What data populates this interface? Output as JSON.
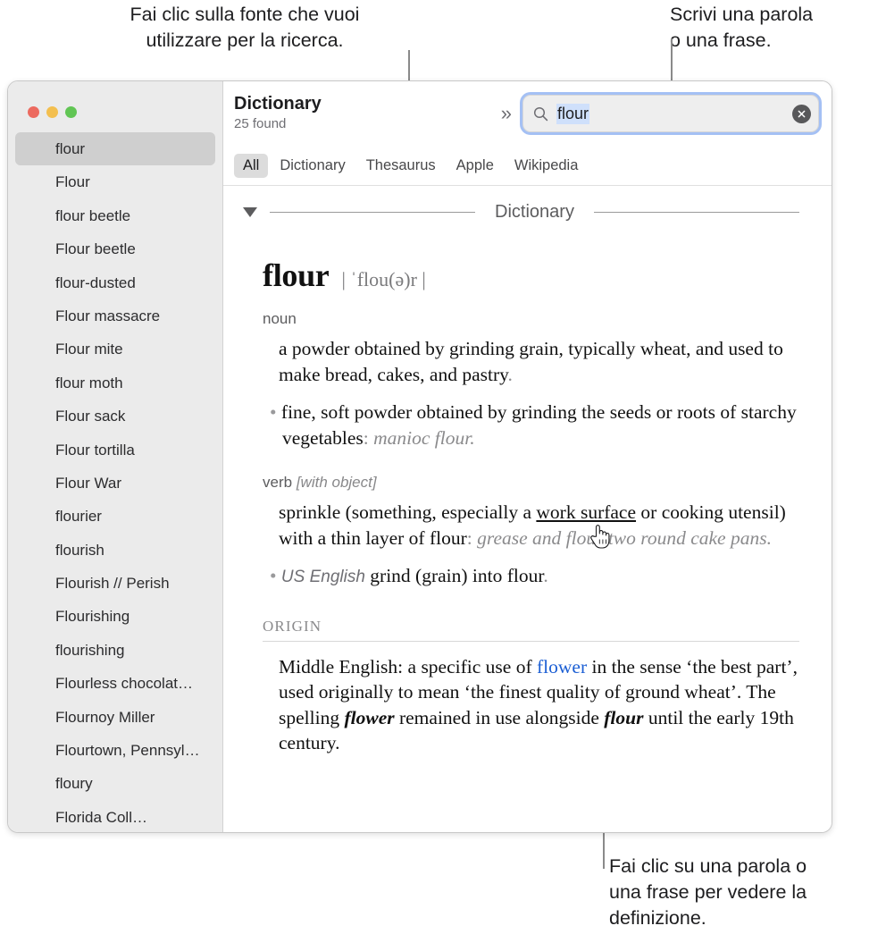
{
  "callouts": {
    "source": "Fai clic sulla fonte che vuoi\nutilizzare per la ricerca.",
    "search": "Scrivi una parola\no una frase.",
    "word": "Fai clic su una parola o\nuna frase per vedere la\ndefinizione."
  },
  "window": {
    "traffic_lights": {
      "close": "close-button",
      "minimize": "minimize-button",
      "maximize": "maximize-button"
    }
  },
  "sidebar": {
    "items": [
      {
        "label": "flour",
        "selected": true
      },
      {
        "label": "Flour",
        "selected": false
      },
      {
        "label": "flour beetle",
        "selected": false
      },
      {
        "label": "Flour beetle",
        "selected": false
      },
      {
        "label": "flour-dusted",
        "selected": false
      },
      {
        "label": "Flour massacre",
        "selected": false
      },
      {
        "label": "Flour mite",
        "selected": false
      },
      {
        "label": "flour moth",
        "selected": false
      },
      {
        "label": "Flour sack",
        "selected": false
      },
      {
        "label": "Flour tortilla",
        "selected": false
      },
      {
        "label": "Flour War",
        "selected": false
      },
      {
        "label": "flourier",
        "selected": false
      },
      {
        "label": "flourish",
        "selected": false
      },
      {
        "label": "Flourish // Perish",
        "selected": false
      },
      {
        "label": "Flourishing",
        "selected": false
      },
      {
        "label": "flourishing",
        "selected": false
      },
      {
        "label": "Flourless chocolat…",
        "selected": false
      },
      {
        "label": "Flournoy Miller",
        "selected": false
      },
      {
        "label": "Flourtown, Pennsyl…",
        "selected": false
      },
      {
        "label": "floury",
        "selected": false
      },
      {
        "label": "Florida Coll…",
        "selected": false
      }
    ]
  },
  "toolbar": {
    "title": "Dictionary",
    "subtitle": "25 found",
    "overflow_chevrons": "»",
    "search": {
      "value": "flour",
      "placeholder": "Search",
      "icon": "search-icon",
      "clear_icon": "clear-circle-icon"
    }
  },
  "tabs": [
    {
      "label": "All",
      "active": true
    },
    {
      "label": "Dictionary",
      "active": false
    },
    {
      "label": "Thesaurus",
      "active": false
    },
    {
      "label": "Apple",
      "active": false
    },
    {
      "label": "Wikipedia",
      "active": false
    }
  ],
  "article": {
    "section_title": "Dictionary",
    "headword": "flour",
    "pronunciation": "| ˈflou(ə)r |",
    "noun": {
      "pos": "noun",
      "sense_main_a": "a powder obtained by grinding grain, typically wheat, and used to make bread, cakes, and pastry",
      "sense_main_punct": ".",
      "sub_bullet": "•",
      "sub_text_a": "fine, soft powder obtained by grinding the seeds or roots of starchy vegetables",
      "sub_colon": ":",
      "sub_example": " manioc flour."
    },
    "verb": {
      "pos": "verb",
      "grammar": "[with object]",
      "sense_pre": "sprinkle (something, especially a ",
      "sense_link": "work surface",
      "sense_post": " or cooking utensil) with a thin layer of flour",
      "sense_colon": ":",
      "sense_example": " grease and flour two round cake pans.",
      "sub_bullet": "•",
      "sub_label": "US English",
      "sub_text": " grind (grain) into flour",
      "sub_punct": "."
    },
    "origin": {
      "label": "ORIGIN",
      "t1": "Middle English: a specific use of ",
      "link": "flower",
      "t2": " in the sense ‘the best part’, used originally to mean ‘the finest quality of ground wheat’. The spelling ",
      "bold1": "flower",
      "t3": " remained in use alongside ",
      "bold2": "flour",
      "t4": " until the early 19th century."
    }
  },
  "cursor": {
    "type": "pointing-hand-cursor"
  },
  "colors": {
    "focus_ring": "#a4c0f4",
    "selection": "#cfe0fb",
    "link": "#1c5fd4",
    "sidebar_bg": "#ebebeb",
    "selected_row": "#cfcfcf",
    "traffic_close": "#ec6a5f",
    "traffic_min": "#f3bf4f",
    "traffic_max": "#61c554"
  }
}
